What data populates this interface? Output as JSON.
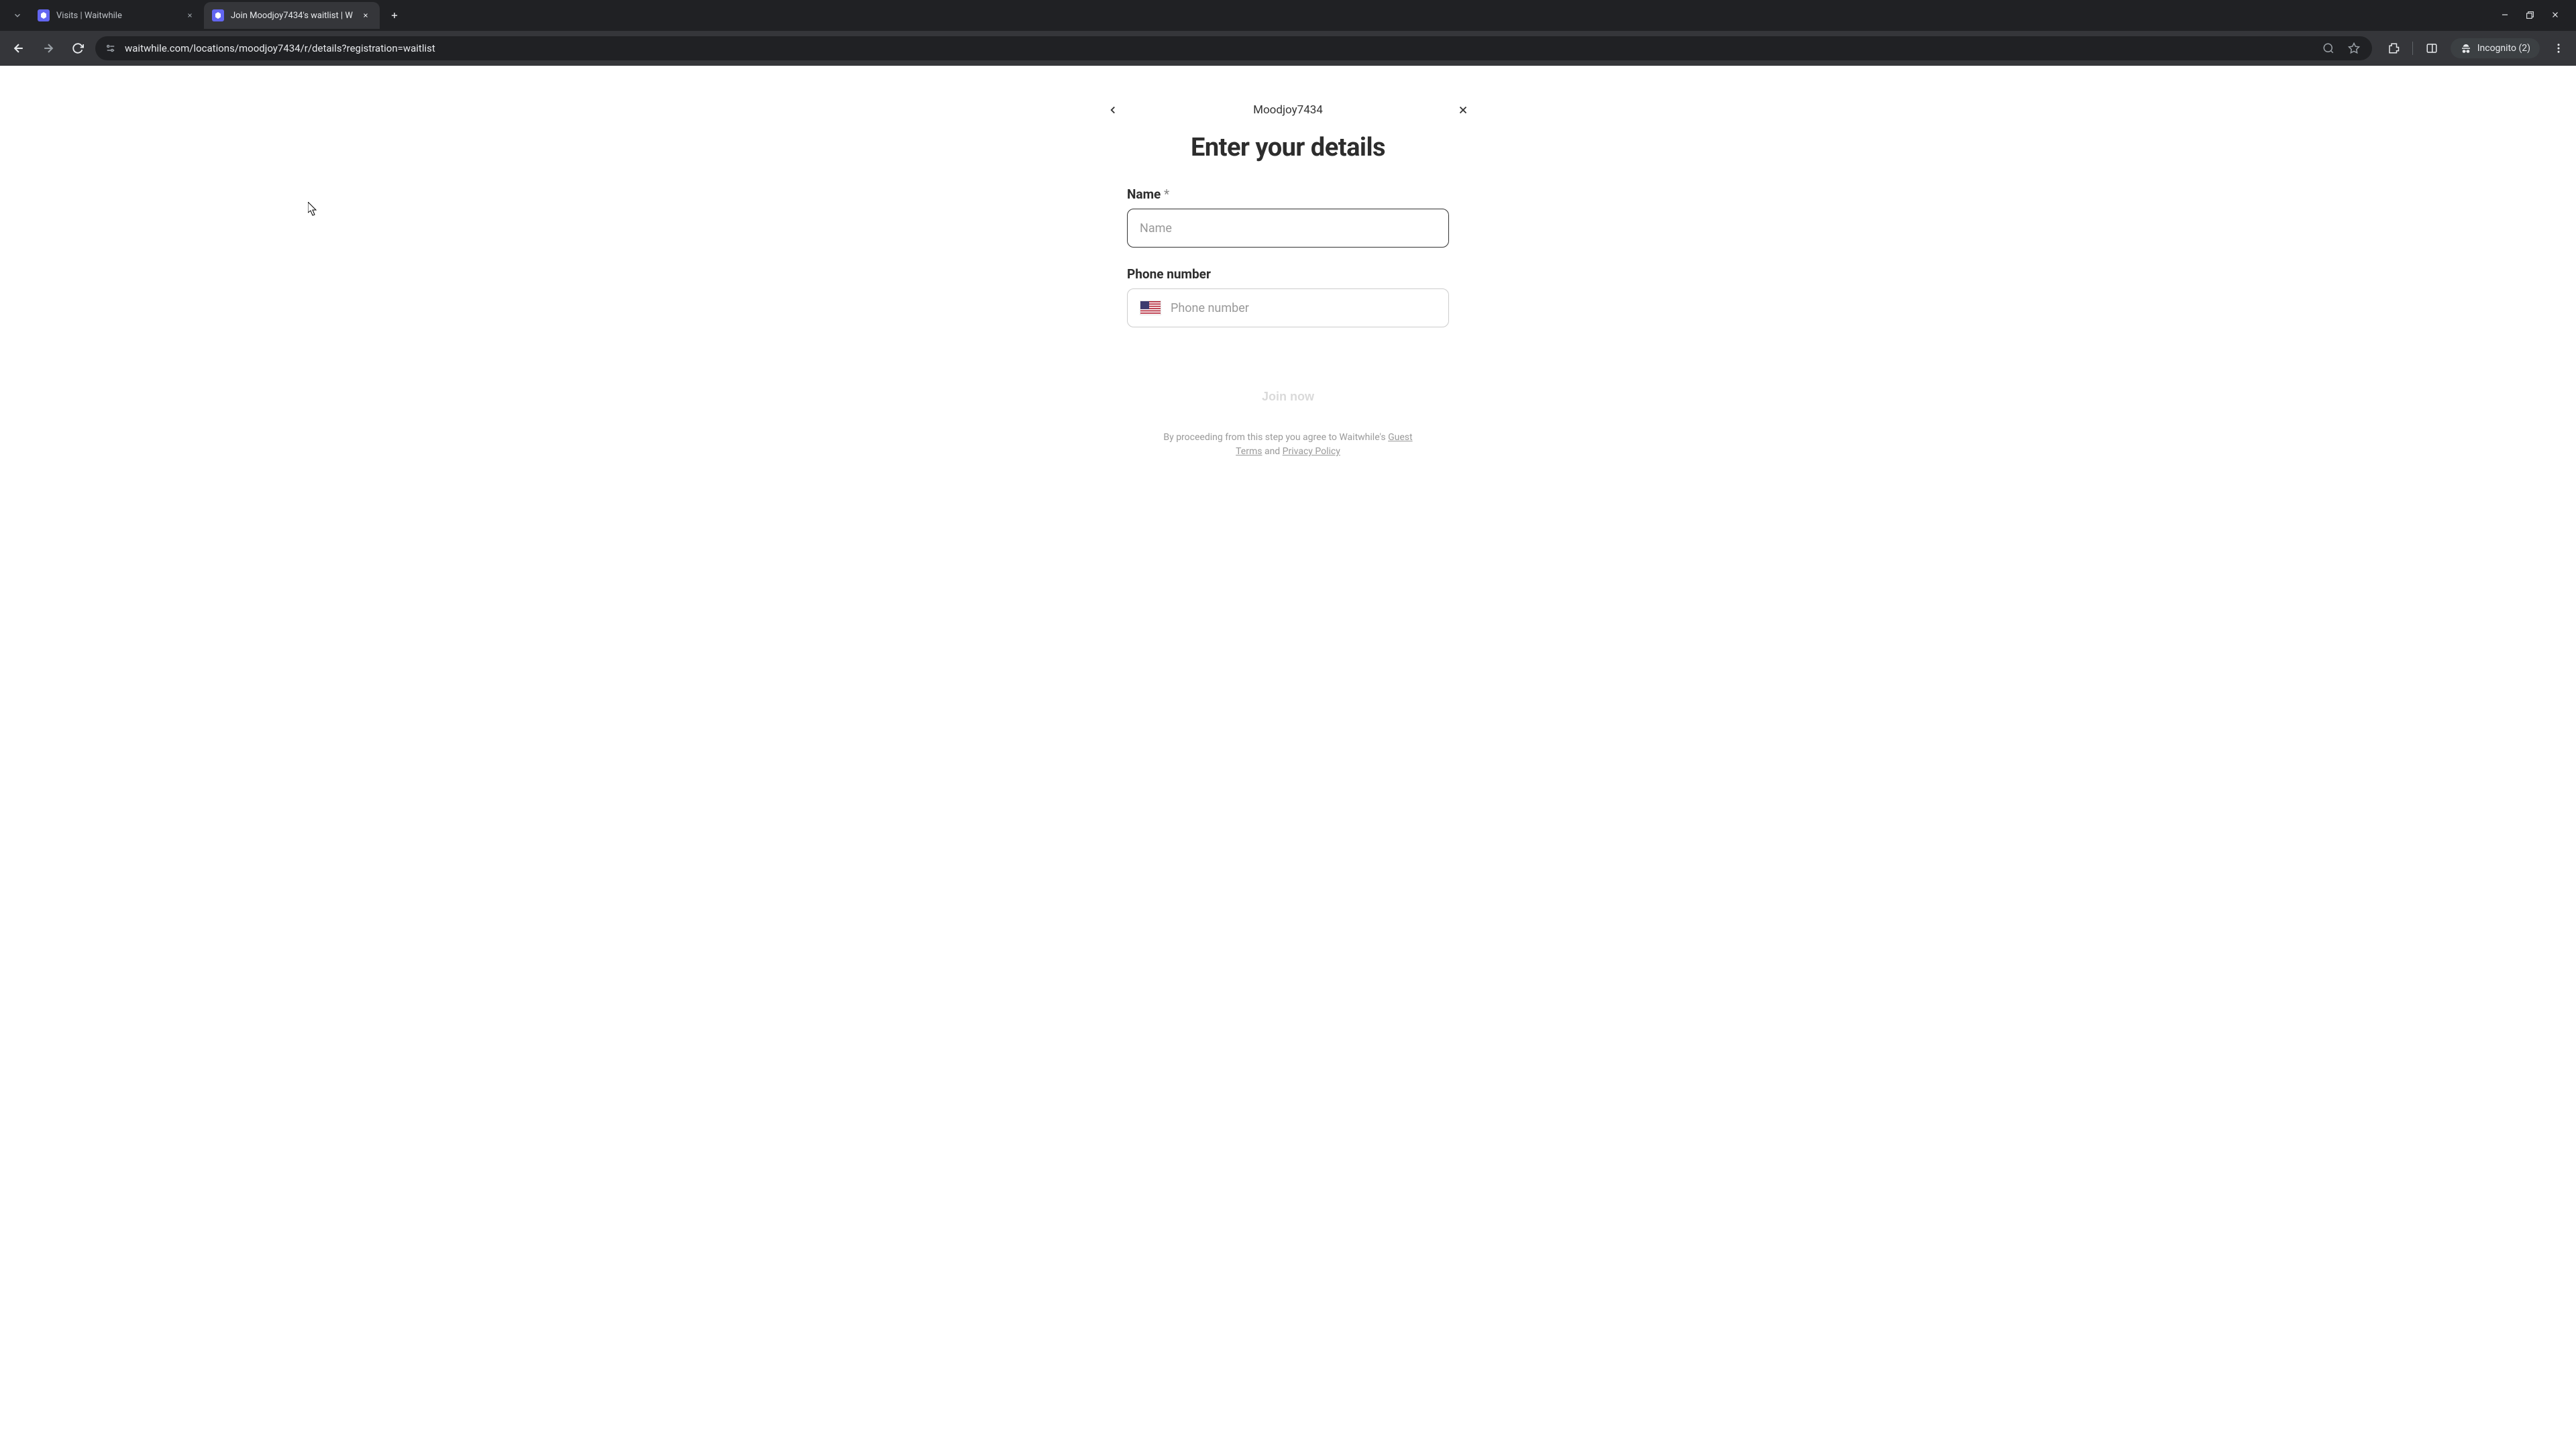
{
  "browser": {
    "tabs": [
      {
        "title": "Visits | Waitwhile",
        "active": false
      },
      {
        "title": "Join Moodjoy7434's waitlist | W",
        "active": true
      }
    ],
    "url": "waitwhile.com/locations/moodjoy7434/r/details?registration=waitlist",
    "incognito_label": "Incognito (2)"
  },
  "page": {
    "location_name": "Moodjoy7434",
    "heading": "Enter your details",
    "fields": {
      "name": {
        "label": "Name",
        "required_marker": "*",
        "placeholder": "Name",
        "value": ""
      },
      "phone": {
        "label": "Phone number",
        "placeholder": "Phone number",
        "value": ""
      }
    },
    "submit_label": "Join now",
    "legal": {
      "prefix": "By proceeding from this step you agree to Waitwhile's ",
      "terms_label": "Guest Terms",
      "and": " and ",
      "privacy_label": "Privacy Policy"
    }
  }
}
